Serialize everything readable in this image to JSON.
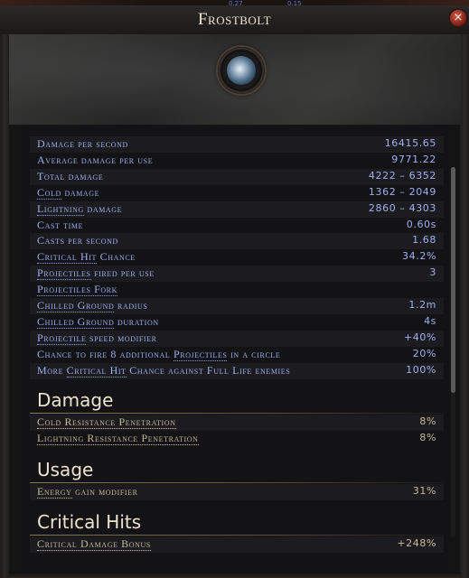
{
  "window": {
    "title": "Frostbolt",
    "close_glyph": "×"
  },
  "top_strip": {
    "left_text": "0.27",
    "right_text": "0.15"
  },
  "icon": {
    "name": "frostbolt-skill-icon"
  },
  "stats": [
    {
      "pre": "Damage per second",
      "val": "16415.65"
    },
    {
      "pre": "Average damage per use",
      "val": "9771.22"
    },
    {
      "pre": "Total damage",
      "val": "4222 – 6352"
    },
    {
      "pre": "",
      "u": "Cold",
      "post": " damage",
      "val": "1362 – 2049"
    },
    {
      "pre": "",
      "u": "Lightning",
      "post": " damage",
      "val": "2860 – 4303"
    },
    {
      "pre": "Cast time",
      "val": "0.60s"
    },
    {
      "pre": "Casts per second",
      "val": "1.68"
    },
    {
      "pre": "",
      "u": "Critical Hit",
      "post": " Chance",
      "val": "34.2%"
    },
    {
      "pre": "",
      "u": "Projectiles",
      "post": " fired per use",
      "val": "3"
    },
    {
      "pre": "",
      "u": "Projectiles Fork",
      "post": "",
      "val": ""
    },
    {
      "pre": "",
      "u": "Chilled Ground",
      "post": " radius",
      "val": "1.2m"
    },
    {
      "pre": "",
      "u": "Chilled Ground",
      "post": " duration",
      "val": "4s"
    },
    {
      "pre": "",
      "u": "Projectile",
      "post": " speed modifier",
      "val": "+40%"
    },
    {
      "pre": "Chance to fire 8 additional ",
      "u": "Projectiles",
      "post": " in a circle",
      "val": "20%"
    },
    {
      "pre": "More ",
      "u": "Critical Hit",
      "post": " Chance against Full Life enemies",
      "val": "100%"
    }
  ],
  "sections": [
    {
      "title": "Damage",
      "rows": [
        {
          "pre": "",
          "u": "Cold Resistance Penetration",
          "post": "",
          "val": "8%"
        },
        {
          "pre": "",
          "u": "Lightning Resistance Penetration",
          "post": "",
          "val": "8%"
        }
      ]
    },
    {
      "title": "Usage",
      "rows": [
        {
          "pre": "",
          "u": "Energy",
          "post": " gain modifier",
          "val": "31%"
        }
      ]
    },
    {
      "title": "Critical Hits",
      "rows": [
        {
          "pre": "",
          "u": "Critical Damage Bonus",
          "post": "",
          "val": "+248%"
        }
      ]
    }
  ],
  "colors": {
    "stat_text": "#9fb0ef",
    "modifier_text": "#c6ba97",
    "title_text": "#efe6d2"
  }
}
